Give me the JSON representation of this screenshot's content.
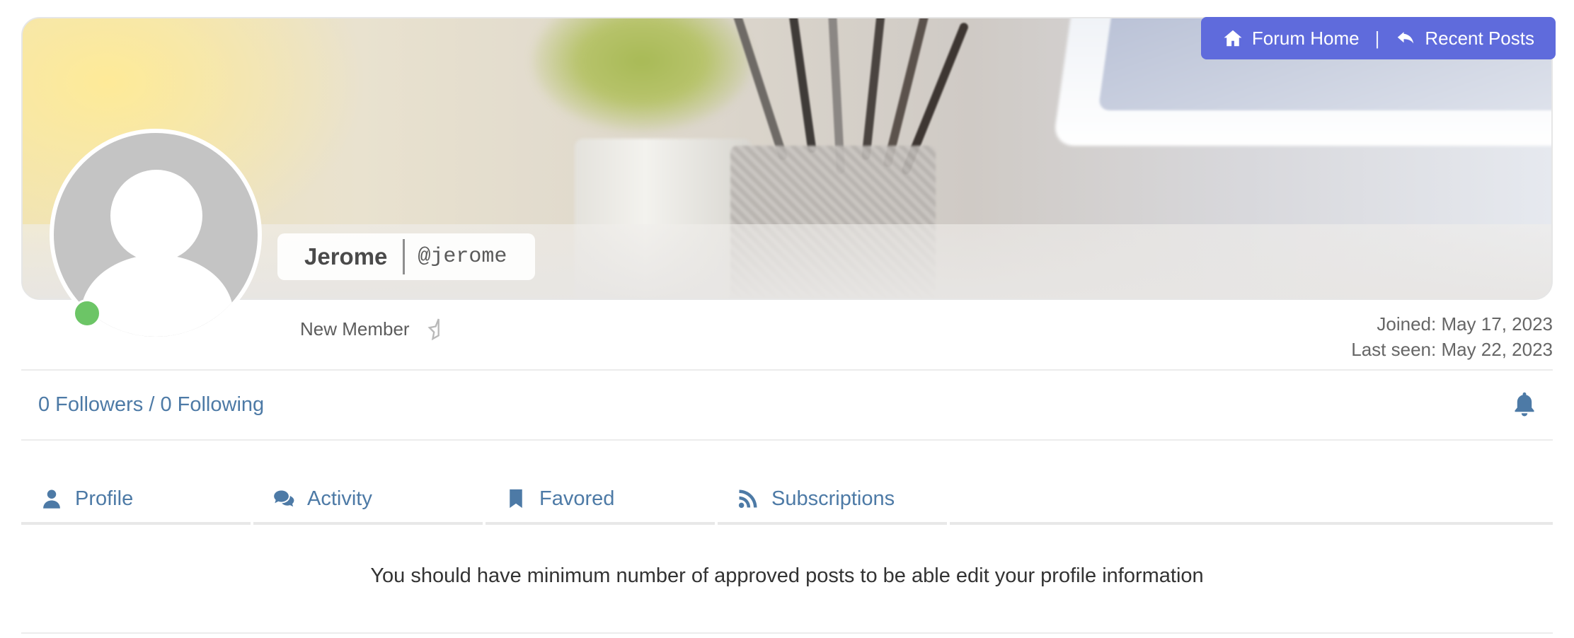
{
  "nav": {
    "forum_home": "Forum Home",
    "separator": "|",
    "recent_posts": "Recent Posts"
  },
  "profile": {
    "display_name": "Jerome",
    "username": "@jerome",
    "rank": "New Member",
    "joined": "Joined: May 17, 2023",
    "last_seen": "Last seen: May 22, 2023",
    "online": true
  },
  "social": {
    "followers": "0 Followers",
    "separator": " / ",
    "following": "0 Following"
  },
  "tabs": [
    {
      "label": "Profile",
      "icon": "user-icon"
    },
    {
      "label": "Activity",
      "icon": "comments-icon"
    },
    {
      "label": "Favored",
      "icon": "bookmark-icon"
    },
    {
      "label": "Subscriptions",
      "icon": "rss-icon"
    }
  ],
  "notice": "You should have minimum number of approved posts to be able edit your profile information",
  "colors": {
    "accent": "#4d7aa6",
    "nav_bg": "#5f6bdc",
    "online": "#6cc566",
    "avatar_bg": "#c4c4c4"
  }
}
